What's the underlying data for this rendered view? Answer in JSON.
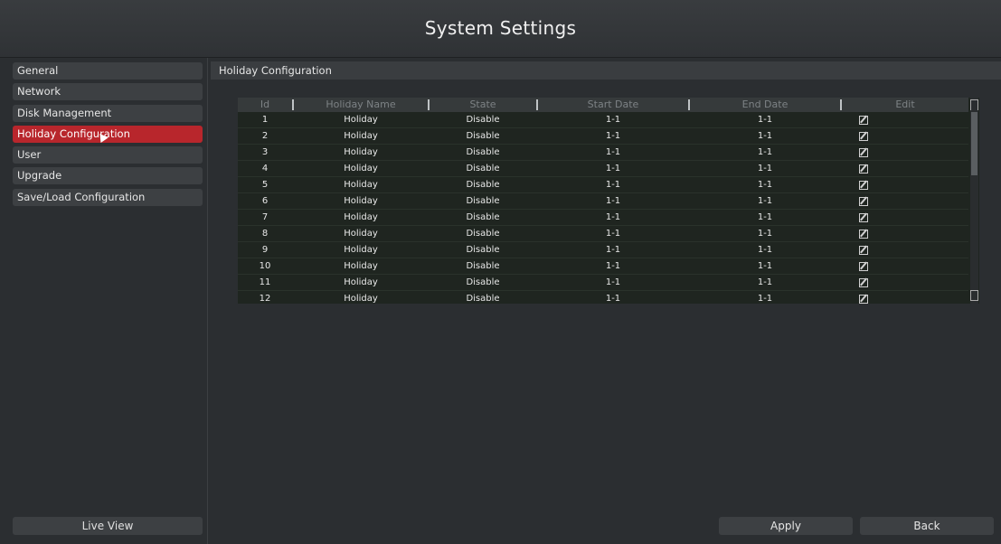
{
  "title": "System Settings",
  "sidebar": {
    "items": [
      {
        "label": "General"
      },
      {
        "label": "Network"
      },
      {
        "label": "Disk Management"
      },
      {
        "label": "Holiday Configuration",
        "active": true
      },
      {
        "label": "User"
      },
      {
        "label": "Upgrade"
      },
      {
        "label": "Save/Load Configuration"
      }
    ],
    "live_view_label": "Live View"
  },
  "content": {
    "header": "Holiday Configuration",
    "table": {
      "columns": [
        "Id",
        "Holiday Name",
        "State",
        "Start Date",
        "End Date",
        "Edit"
      ],
      "rows": [
        {
          "id": "1",
          "name": "Holiday",
          "state": "Disable",
          "start": "1-1",
          "end": "1-1"
        },
        {
          "id": "2",
          "name": "Holiday",
          "state": "Disable",
          "start": "1-1",
          "end": "1-1"
        },
        {
          "id": "3",
          "name": "Holiday",
          "state": "Disable",
          "start": "1-1",
          "end": "1-1"
        },
        {
          "id": "4",
          "name": "Holiday",
          "state": "Disable",
          "start": "1-1",
          "end": "1-1"
        },
        {
          "id": "5",
          "name": "Holiday",
          "state": "Disable",
          "start": "1-1",
          "end": "1-1"
        },
        {
          "id": "6",
          "name": "Holiday",
          "state": "Disable",
          "start": "1-1",
          "end": "1-1"
        },
        {
          "id": "7",
          "name": "Holiday",
          "state": "Disable",
          "start": "1-1",
          "end": "1-1"
        },
        {
          "id": "8",
          "name": "Holiday",
          "state": "Disable",
          "start": "1-1",
          "end": "1-1"
        },
        {
          "id": "9",
          "name": "Holiday",
          "state": "Disable",
          "start": "1-1",
          "end": "1-1"
        },
        {
          "id": "10",
          "name": "Holiday",
          "state": "Disable",
          "start": "1-1",
          "end": "1-1"
        },
        {
          "id": "11",
          "name": "Holiday",
          "state": "Disable",
          "start": "1-1",
          "end": "1-1"
        },
        {
          "id": "12",
          "name": "Holiday",
          "state": "Disable",
          "start": "1-1",
          "end": "1-1"
        }
      ],
      "edit_icon": "edit-icon"
    }
  },
  "footer": {
    "apply_label": "Apply",
    "back_label": "Back"
  },
  "colors": {
    "accent": "#b8262c",
    "background": "#2b2e31",
    "table_background": "#1f2520"
  }
}
